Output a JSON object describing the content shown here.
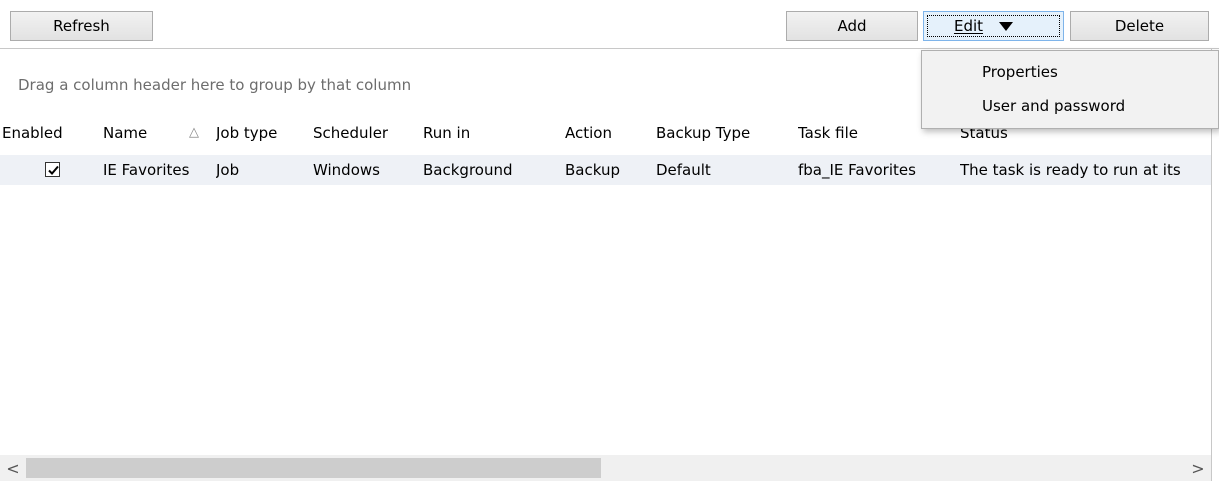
{
  "toolbar": {
    "refresh_label": "Refresh",
    "add_label": "Add",
    "edit_label": "Edit",
    "delete_label": "Delete"
  },
  "edit_menu": {
    "items": [
      "Properties",
      "User and password"
    ]
  },
  "grid": {
    "group_panel_text": "Drag a column header here to group by that column",
    "columns": [
      "Enabled",
      "Name",
      "Job type",
      "Scheduler",
      "Run in",
      "Action",
      "Backup Type",
      "Task file",
      "Status"
    ],
    "sort_indicator": "△",
    "rows": [
      {
        "enabled": true,
        "name": "IE Favorites",
        "job_type": "Job",
        "scheduler": "Windows",
        "run_in": "Background",
        "action": "Backup",
        "backup_type": "Default",
        "task_file": "fba_IE Favorites",
        "status": "The task is ready to run at its"
      }
    ]
  },
  "scrollbar": {
    "left_arrow": "<",
    "right_arrow": ">"
  },
  "colors": {
    "row_background": "#eef1f6",
    "edit_button_highlight": "#e5f1fb",
    "group_panel_text": "#6d6d6d"
  }
}
